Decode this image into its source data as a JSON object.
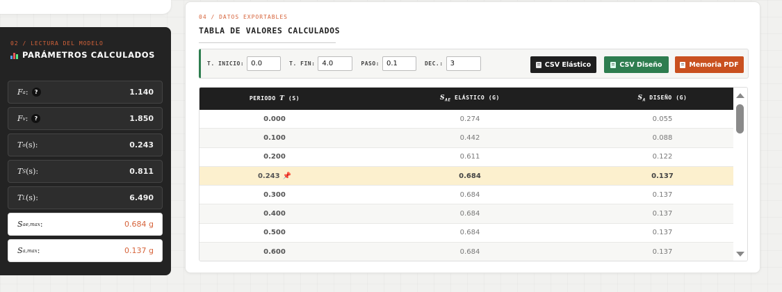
{
  "params_panel": {
    "eyebrow": "02 / LECTURA DEL MODELO",
    "title": "PARÁMETROS CALCULADOS",
    "rows": [
      {
        "symbol": "F",
        "sub": "a",
        "suffix": ":",
        "help": "?",
        "value": "1.140",
        "style": "dark"
      },
      {
        "symbol": "F",
        "sub": "v",
        "suffix": ":",
        "help": "?",
        "value": "1.850",
        "style": "dark"
      },
      {
        "symbol": "T",
        "sub": "o",
        "suffix": " (s):",
        "value": "0.243",
        "style": "dark"
      },
      {
        "symbol": "T",
        "sub": "S",
        "suffix": " (s):",
        "value": "0.811",
        "style": "dark"
      },
      {
        "symbol": "T",
        "sub": "L",
        "suffix": " (s):",
        "value": "6.490",
        "style": "dark"
      },
      {
        "symbol": "S",
        "sub": "ae,max",
        "suffix": ":",
        "value": "0.684 g",
        "style": "light"
      },
      {
        "symbol": "S",
        "sub": "a,max",
        "suffix": ":",
        "value": "0.137 g",
        "style": "light"
      }
    ]
  },
  "table_section": {
    "eyebrow": "04 / DATOS EXPORTABLES",
    "title": "TABLA DE VALORES CALCULADOS",
    "toolbar": {
      "t_start_label": "T. INICIO:",
      "t_start_value": "0.0",
      "t_end_label": "T. FIN:",
      "t_end_value": "4.0",
      "step_label": "PASO:",
      "step_value": "0.1",
      "decimals_label": "DEC.:",
      "decimals_value": "3",
      "btn_csv_elastic": "CSV Elástico",
      "btn_csv_design": "CSV Diseño",
      "btn_pdf": "Memoria PDF"
    },
    "columns": {
      "period": {
        "pre": "PERIODO ",
        "sym": "T",
        "post": " (S)"
      },
      "elastic": {
        "sym": "S",
        "sub": "AE",
        "post": " ELÁSTICO (G)"
      },
      "design": {
        "sym": "S",
        "sub": "A",
        "post": " DISEÑO (G)"
      }
    },
    "rows": [
      {
        "period": "0.000",
        "elastic": "0.274",
        "design": "0.055",
        "highlight": false
      },
      {
        "period": "0.100",
        "elastic": "0.442",
        "design": "0.088",
        "highlight": false
      },
      {
        "period": "0.200",
        "elastic": "0.611",
        "design": "0.122",
        "highlight": false
      },
      {
        "period": "0.243",
        "elastic": "0.684",
        "design": "0.137",
        "highlight": true
      },
      {
        "period": "0.300",
        "elastic": "0.684",
        "design": "0.137",
        "highlight": false
      },
      {
        "period": "0.400",
        "elastic": "0.684",
        "design": "0.137",
        "highlight": false
      },
      {
        "period": "0.500",
        "elastic": "0.684",
        "design": "0.137",
        "highlight": false
      },
      {
        "period": "0.600",
        "elastic": "0.684",
        "design": "0.137",
        "highlight": false
      }
    ]
  },
  "icons": {
    "chart": "bar-chart-icon",
    "pin": "pushpin-icon",
    "disk": "floppy-icon",
    "doc": "document-icon"
  }
}
